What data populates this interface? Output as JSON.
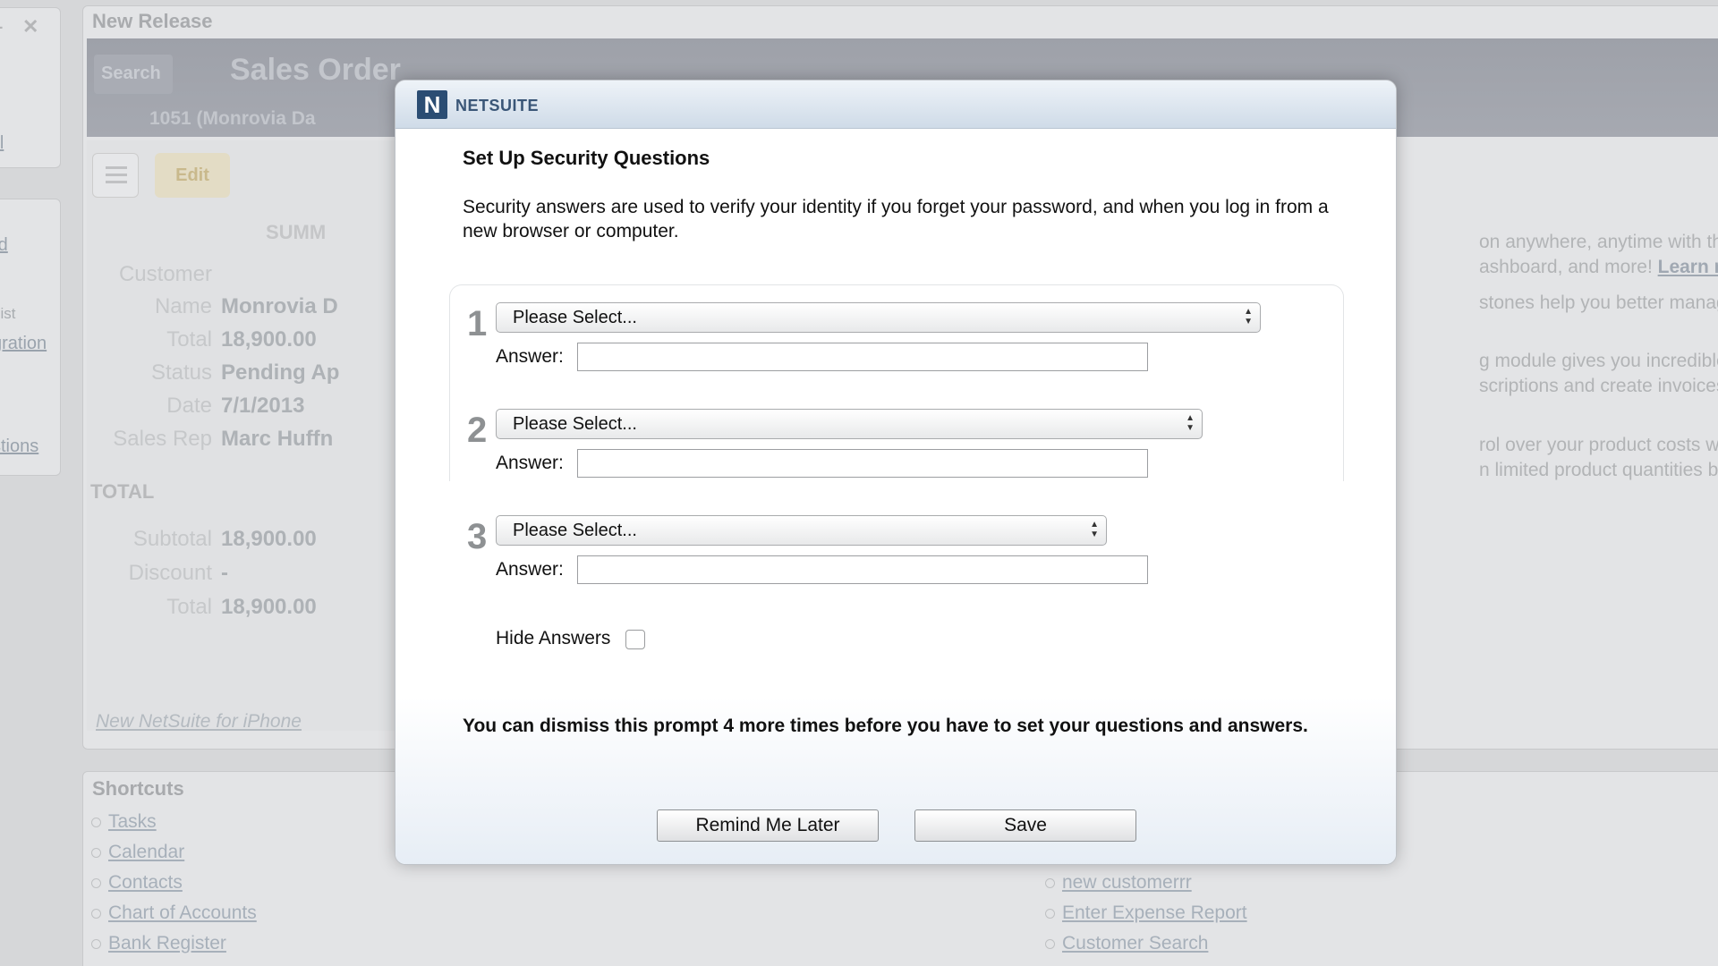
{
  "background": {
    "window_controls": {
      "minimize": "–",
      "close": "✕"
    },
    "left_links": [
      "ill",
      "rd",
      "List",
      "gration",
      "stions"
    ],
    "main_title": "New Release",
    "banner": {
      "search_tab": "Search",
      "title": "Sales Order",
      "subtitle": "1051 (Monrovia Da"
    },
    "card": {
      "edit": "Edit",
      "summary": "SUMM",
      "fields": [
        {
          "k": "Customer",
          "v": ""
        },
        {
          "k": "Name",
          "v": "Monrovia D"
        },
        {
          "k": "Total",
          "v": "18,900.00"
        },
        {
          "k": "Status",
          "v": "Pending Ap"
        },
        {
          "k": "Date",
          "v": "7/1/2013"
        },
        {
          "k": "Sales Rep",
          "v": "Marc Huffn"
        }
      ],
      "total_heading": "TOTAL",
      "totals": [
        {
          "k": "Subtotal",
          "v": "18,900.00"
        },
        {
          "k": "Discount",
          "v": "-"
        },
        {
          "k": "Total",
          "v": "18,900.00"
        }
      ],
      "iphone_link": "New NetSuite for iPhone"
    },
    "promo_lines": [
      "on anywhere, anytime with the new N",
      "ashboard, and more! ",
      "stones help you better manage projec",
      "g module gives you incredible flexibili",
      "scriptions and create invoices automa",
      "rol over your product costs with Enha",
      "n limited product quantities based or"
    ],
    "promo_learn_more": "Learn more...",
    "shortcuts": {
      "title": "Shortcuts",
      "left": [
        "Tasks",
        "Calendar",
        "Contacts",
        "Chart of Accounts",
        "Bank Register"
      ],
      "right": [
        "new customerrr",
        "Enter Expense Report",
        "Customer Search"
      ]
    }
  },
  "dialog": {
    "logo_mark": "N",
    "logo_text": "NETSUITE",
    "title": "Set Up Security Questions",
    "description": "Security answers are used to verify your identity if you forget your password, and when you log in from a new browser or computer.",
    "questions": [
      {
        "number": "1",
        "select_value": "Please Select...",
        "answer_label": "Answer:",
        "answer_value": ""
      },
      {
        "number": "2",
        "select_value": "Please Select...",
        "answer_label": "Answer:",
        "answer_value": ""
      },
      {
        "number": "3",
        "select_value": "Please Select...",
        "answer_label": "Answer:",
        "answer_value": ""
      }
    ],
    "hide_answers_label": "Hide Answers",
    "hide_answers_checked": false,
    "dismiss_text": "You can dismiss this prompt 4 more times before you have to set your questions and answers.",
    "remind_button": "Remind Me Later",
    "save_button": "Save"
  }
}
